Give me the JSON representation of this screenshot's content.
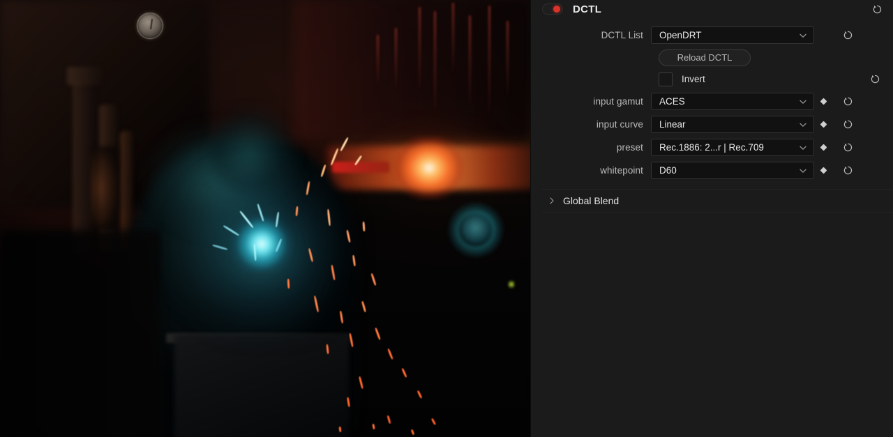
{
  "panel": {
    "title": "DCTL",
    "toggle_state": "on",
    "accent_color": "#d8322a",
    "panel_bg": "#1b1b1b",
    "field_bg": "#111111",
    "header_reset_icon": "reset-arrow-icon",
    "rows": [
      {
        "label": "DCTL List",
        "value": "OpenDRT",
        "icon": "chevron-down-icon",
        "has_keyframe": false,
        "has_reset": true
      },
      {
        "label": "input gamut",
        "value": "ACES",
        "icon": "chevron-down-icon",
        "has_keyframe": true,
        "has_reset": true
      },
      {
        "label": "input curve",
        "value": "Linear",
        "icon": "chevron-down-icon",
        "has_keyframe": true,
        "has_reset": true
      },
      {
        "label": "preset",
        "value": "Rec.1886: 2...r | Rec.709",
        "icon": "chevron-down-icon",
        "has_keyframe": true,
        "has_reset": true
      },
      {
        "label": "whitepoint",
        "value": "D60",
        "icon": "chevron-down-icon",
        "has_keyframe": true,
        "has_reset": true
      }
    ],
    "reload_button": "Reload DCTL",
    "invert": {
      "label": "Invert",
      "checked": false
    },
    "global_blend": {
      "label": "Global Blend",
      "expanded": false,
      "icon": "chevron-right-icon"
    }
  },
  "viewer": {
    "scene_description": "welder-workshop-image",
    "glow_orange": "#ff6e2d",
    "glow_teal": "#46dcf0"
  }
}
